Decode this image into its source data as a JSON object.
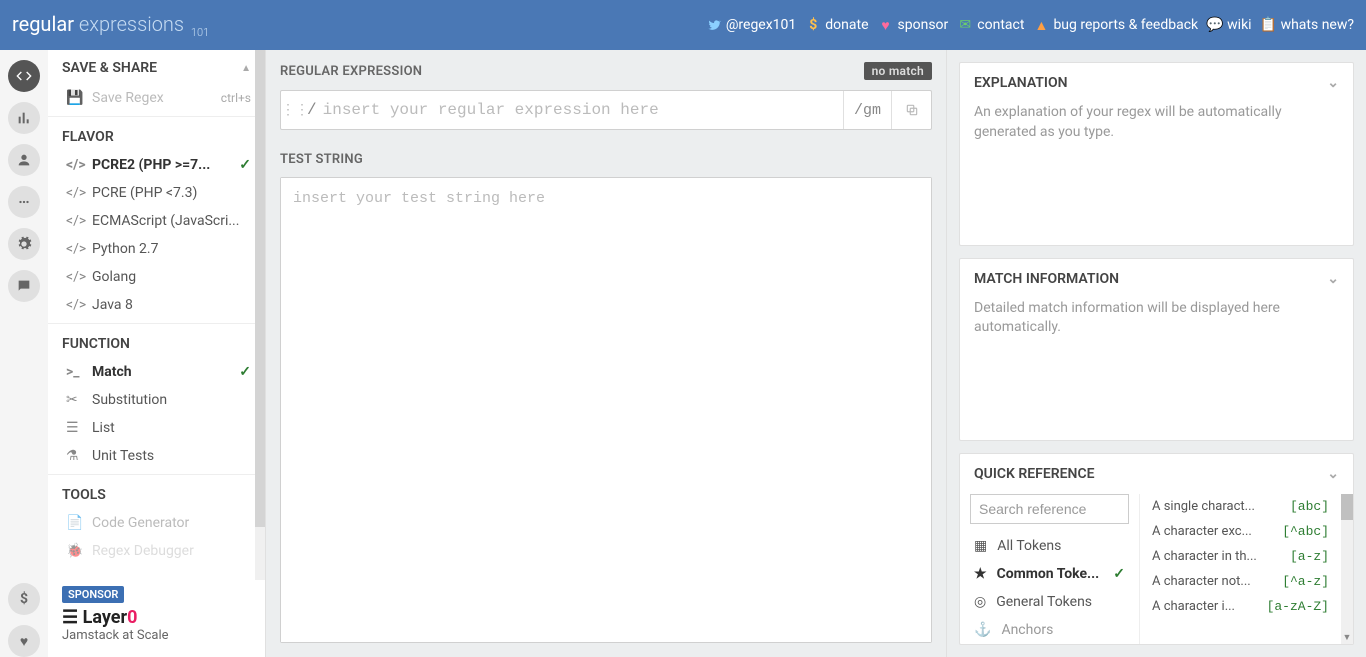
{
  "logo": {
    "part1": "regular",
    "part2": "expressions",
    "sub": "101"
  },
  "header": {
    "twitter": "@regex101",
    "donate": "donate",
    "sponsor": "sponsor",
    "contact": "contact",
    "bugs": "bug reports & feedback",
    "wiki": "wiki",
    "whatsnew": "whats new?"
  },
  "sidebar": {
    "save_share": "SAVE & SHARE",
    "save_regex": "Save Regex",
    "save_shortcut": "ctrl+s",
    "flavor": "FLAVOR",
    "flavors": [
      "PCRE2 (PHP >=7...",
      "PCRE (PHP <7.3)",
      "ECMAScript (JavaScri...",
      "Python 2.7",
      "Golang",
      "Java 8"
    ],
    "function": "FUNCTION",
    "functions": [
      "Match",
      "Substitution",
      "List",
      "Unit Tests"
    ],
    "tools": "TOOLS",
    "tool_items": [
      "Code Generator",
      "Regex Debugger"
    ],
    "sponsor_badge": "SPONSOR",
    "sponsor_name_a": "Layer",
    "sponsor_name_b": "0",
    "sponsor_tag": "Jamstack at Scale"
  },
  "editor": {
    "regex_title": "REGULAR EXPRESSION",
    "no_match": "no match",
    "regex_placeholder": "insert your regular expression here",
    "flags_prefix": "/ ",
    "flags": "gm",
    "test_title": "TEST STRING",
    "test_placeholder": "insert your test string here"
  },
  "info": {
    "explanation_title": "EXPLANATION",
    "explanation_body": "An explanation of your regex will be automatically generated as you type.",
    "match_title": "MATCH INFORMATION",
    "match_body": "Detailed match information will be displayed here automatically.",
    "quickref_title": "QUICK REFERENCE",
    "search_placeholder": "Search reference",
    "categories": [
      "All Tokens",
      "Common Toke...",
      "General Tokens",
      "Anchors"
    ],
    "items": [
      {
        "label": "A single charact...",
        "code": "[abc]"
      },
      {
        "label": "A character exc...",
        "code": "[^abc]"
      },
      {
        "label": "A character in th...",
        "code": "[a-z]"
      },
      {
        "label": "A character not...",
        "code": "[^a-z]"
      },
      {
        "label": "A character i...",
        "code": "[a-zA-Z]"
      }
    ]
  }
}
